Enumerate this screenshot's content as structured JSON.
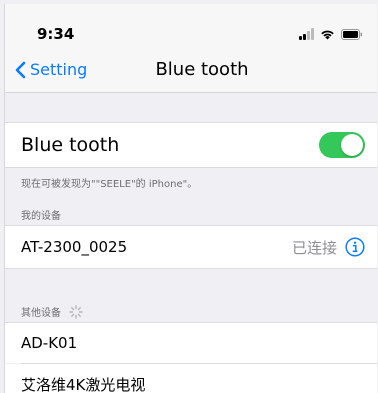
{
  "status_bar": {
    "time": "9:34"
  },
  "nav": {
    "back_label": "Setting",
    "title": "Blue tooth"
  },
  "bluetooth": {
    "label": "Blue tooth",
    "enabled": true,
    "discoverable_note": "现在可被发现为\"\"SEELE\"的 iPhone\"。"
  },
  "my_devices": {
    "header": "我的设备",
    "items": [
      {
        "name": "AT-2300_0025",
        "status": "已连接"
      }
    ]
  },
  "other_devices": {
    "header": "其他设备",
    "items": [
      {
        "name": "AD-K01"
      },
      {
        "name": "艾洛维4K激光电视"
      }
    ]
  },
  "colors": {
    "accent": "#0a7cff",
    "toggle_on": "#34c759",
    "background": "#efeff4"
  }
}
